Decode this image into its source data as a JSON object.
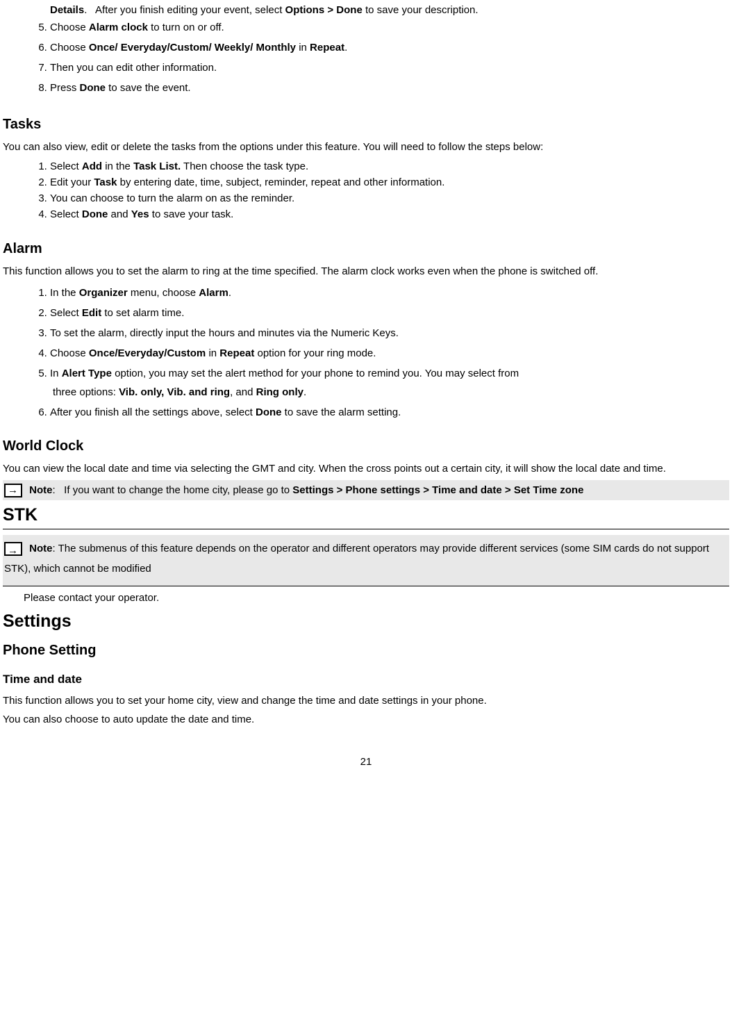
{
  "events": {
    "step4_part": "<b>Details</b>. &nbsp; After you finish editing your event, select <b>Options > Done</b> to save your description.",
    "step5": "Choose <b>Alarm clock</b> to turn on or off.",
    "step6": "Choose <b>Once/ Everyday/Custom/ Weekly/ Monthly</b> in <b>Repeat</b>.",
    "step7": "Then you can edit other information.",
    "step8": "Press <b>Done</b> to save the event."
  },
  "tasks": {
    "heading": "Tasks",
    "intro": "You can also view, edit or delete the tasks from the options under this feature. You will need to follow the steps below:",
    "step1": "Select <b>Add</b> in the <b>Task List.</b> Then choose the task type.",
    "step2": "Edit your <b>Task</b> by entering date, time, subject, reminder, repeat and other information.",
    "step3": "You can choose to turn the alarm on as the reminder.",
    "step4": "Select <b>Done</b> and <b>Yes</b> to save your task."
  },
  "alarm": {
    "heading": "Alarm",
    "intro": "This function allows you to set the alarm to ring at the time specified. The alarm clock works even when the phone is switched off.",
    "step1": "In the <b>Organizer</b> menu, choose <b>Alarm</b>.",
    "step2": "Select <b>Edit</b> to set alarm time.",
    "step3": "To set the alarm, directly input the hours and minutes via the Numeric Keys.",
    "step4": "Choose <b>Once/Everyday/Custom</b> in <b>Repeat</b> option for your ring mode.",
    "step5": "In <b>Alert Type</b> option, you may set the alert method for your phone to remind you. You may select from",
    "step5b": "three options: <b>Vib. only, Vib. and ring</b>, and <b>Ring only</b>.",
    "step6": "After you finish all the settings above, select <b>Done</b> to save the alarm setting."
  },
  "worldclock": {
    "heading": "World Clock",
    "intro": "You can view the local date and time via selecting the GMT and city. When the cross points out a certain city, it will show the local date and time.",
    "note": "<b>Note</b>: &nbsp; If you want to change the home city, please go to <b>Settings > Phone settings > Time and date > Set Time zone</b>"
  },
  "stk": {
    "heading": "STK",
    "note": "<b>Note</b>: The submenus of this feature depends on the operator and different operators may provide different services (some SIM cards do not support STK), which cannot be modified",
    "after": "Please contact your operator."
  },
  "settings": {
    "heading": "Settings",
    "sub": "Phone Setting",
    "timedate_heading": "Time and date",
    "timedate_body1": "This function allows you to set your home city, view and change the time and date settings in your phone.",
    "timedate_body2": "You can also choose to auto update the date and time."
  },
  "pagenum": "21"
}
